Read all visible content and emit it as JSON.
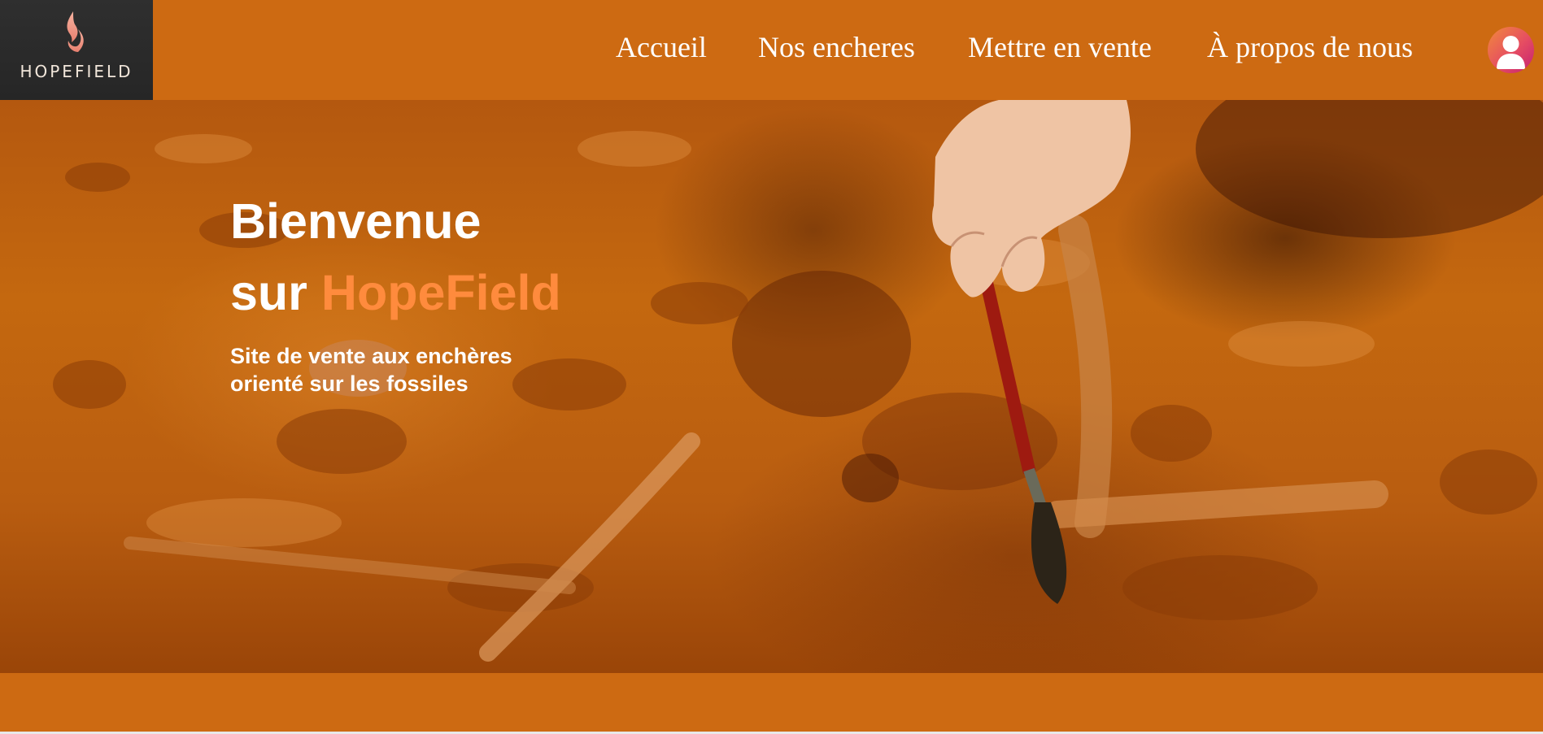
{
  "brand": {
    "logo_text": "HOPEFIELD",
    "logo_icon": "flame-icon"
  },
  "nav": {
    "items": [
      {
        "label": "Accueil"
      },
      {
        "label": "Nos encheres"
      },
      {
        "label": "Mettre en vente"
      },
      {
        "label": "À propos de nous"
      }
    ],
    "user_icon": "user-icon"
  },
  "hero": {
    "title_line1": "Bienvenue",
    "title_line2_prefix": "sur",
    "title_brand": "HopeField",
    "subtitle_line1": "Site de vente aux enchères",
    "subtitle_line2": "orienté sur les fossiles"
  },
  "colors": {
    "header": "#cd6a12",
    "accent": "#ff8b3d",
    "text": "#ffffff",
    "logo_bg": "#2f2f2f"
  }
}
